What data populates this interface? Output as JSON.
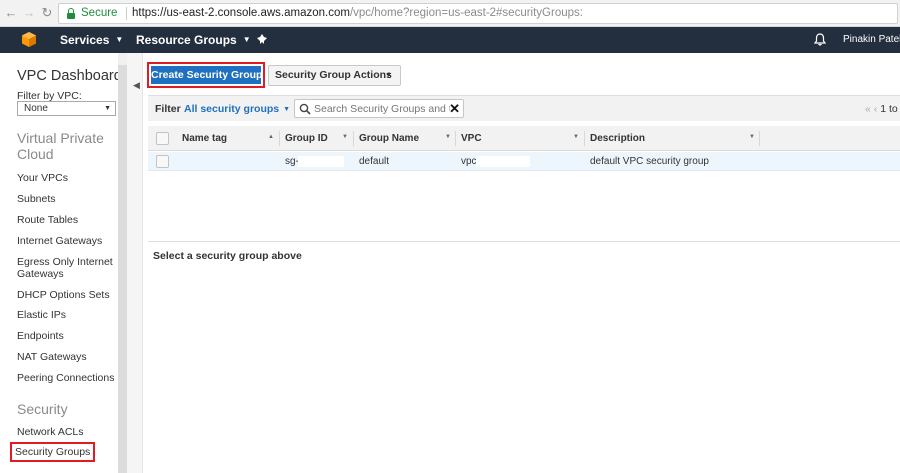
{
  "browser": {
    "back_icon": "arrow-left-icon",
    "forward_icon": "arrow-right-icon",
    "reload_icon": "reload-icon",
    "secure_label": "Secure",
    "url_domain": "https://us-east-2.console.aws.amazon.com",
    "url_path": "/vpc/home?region=us-east-2#securityGroups:"
  },
  "header": {
    "services_label": "Services",
    "resource_groups_label": "Resource Groups",
    "user_name": "Pinakin Patel",
    "colors": {
      "background": "#232f3e",
      "logo": "#f90"
    }
  },
  "sidebar": {
    "title": "VPC Dashboard",
    "filter_label": "Filter by VPC:",
    "filter_value": "None",
    "section_vpc": "Virtual Private Cloud",
    "vpc_items": [
      {
        "label": "Your VPCs"
      },
      {
        "label": "Subnets"
      },
      {
        "label": "Route Tables"
      },
      {
        "label": "Internet Gateways"
      },
      {
        "label": "Egress Only Internet Gateways"
      },
      {
        "label": "DHCP Options Sets"
      },
      {
        "label": "Elastic IPs"
      },
      {
        "label": "Endpoints"
      },
      {
        "label": "NAT Gateways"
      },
      {
        "label": "Peering Connections"
      }
    ],
    "section_security": "Security",
    "security_items": [
      {
        "label": "Network ACLs"
      },
      {
        "label": "Security Groups",
        "active": true
      }
    ]
  },
  "toolbar": {
    "create_label": "Create Security Group",
    "actions_label": "Security Group Actions"
  },
  "filter": {
    "label": "Filter",
    "selected": "All security groups",
    "search_placeholder": "Search Security Groups and their proper",
    "pager": "1 to"
  },
  "table": {
    "columns": [
      "Name tag",
      "Group ID",
      "Group Name",
      "VPC",
      "Description"
    ],
    "rows": [
      {
        "name_tag": "",
        "group_id": "sg-",
        "group_name": "default",
        "vpc": "vpc-",
        "description": "default VPC security group"
      }
    ]
  },
  "detail": {
    "empty_text": "Select a security group above"
  },
  "colors": {
    "primary_button": "#1f70c1",
    "highlight_outline": "#e11b22",
    "secure_green": "#1e8e3e"
  }
}
